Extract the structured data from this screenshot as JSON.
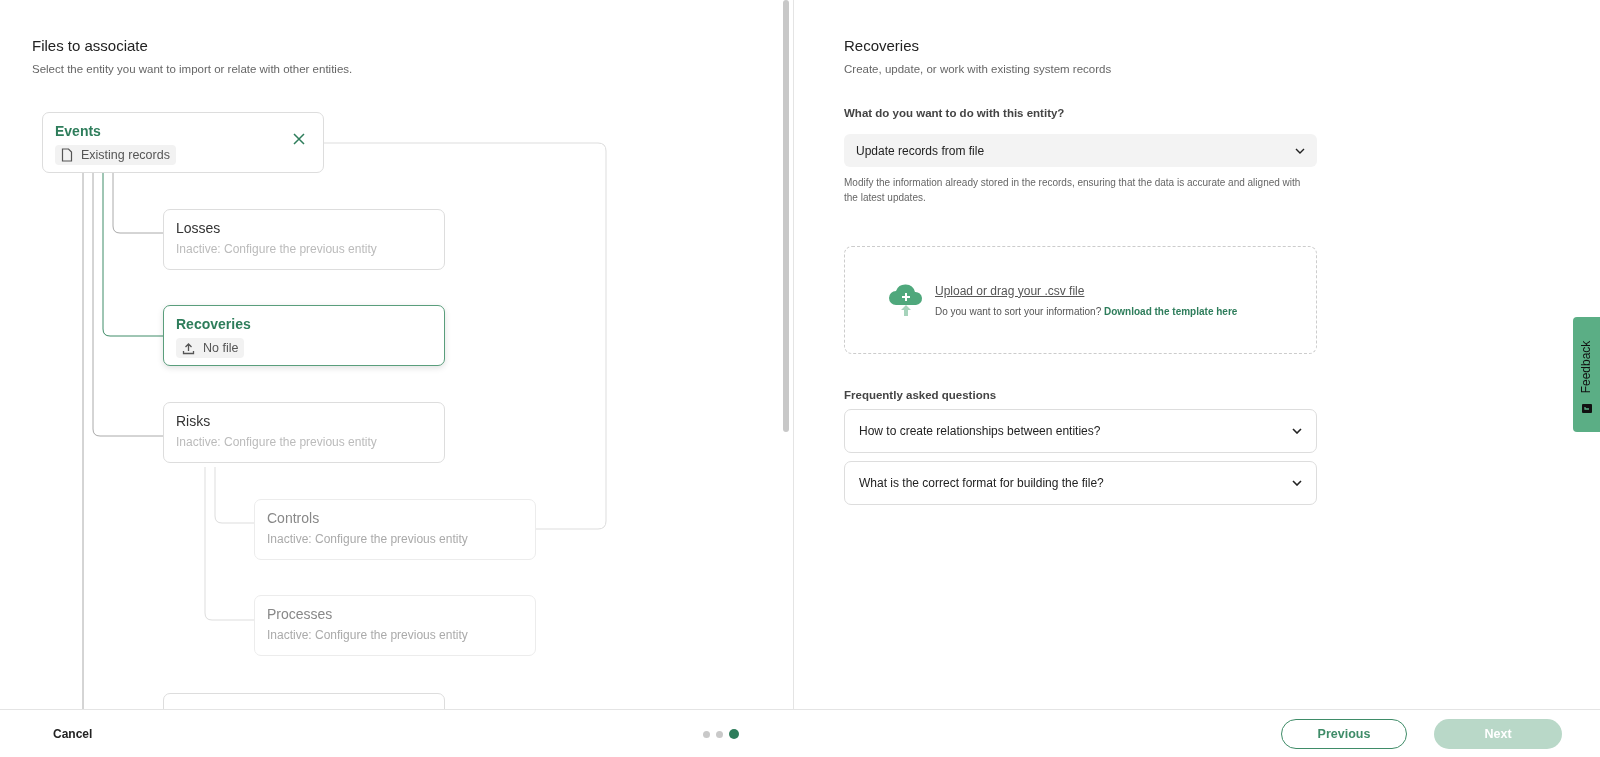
{
  "left_panel": {
    "title": "Files to associate",
    "subtitle": "Select the entity you want to import or relate with other entities."
  },
  "tree": [
    {
      "name": "Events",
      "complete": true,
      "selected": false,
      "disabled": false,
      "chip": {
        "label": "Existing records",
        "kind": "document"
      }
    },
    {
      "name": "Losses",
      "complete": false,
      "selected": false,
      "disabled": false,
      "note": "Inactive: Configure the previous entity"
    },
    {
      "name": "Recoveries",
      "complete": false,
      "selected": true,
      "disabled": false,
      "chip": {
        "label": "No file",
        "kind": "upload"
      }
    },
    {
      "name": "Risks",
      "complete": false,
      "selected": false,
      "disabled": false,
      "note": "Inactive: Configure the previous entity"
    },
    {
      "name": "Controls",
      "complete": false,
      "selected": false,
      "disabled": true,
      "note": "Inactive: Configure the previous entity"
    },
    {
      "name": "Processes",
      "complete": false,
      "selected": false,
      "disabled": true,
      "note": "Inactive: Configure the previous entity"
    },
    {
      "kind": "clipped"
    }
  ],
  "right_panel": {
    "title": "Recoveries",
    "subtitle": "Create, update, or work with existing system records",
    "question": "What do you want to do with this entity?",
    "action_select": {
      "value": "Update records from file"
    },
    "help": "Modify the information already stored in the records, ensuring that the data is accurate and aligned with the latest updates.",
    "upload": {
      "link": "Upload or drag your .csv file",
      "hint": "Do you want to sort your information? **Download the template here**"
    },
    "faq_title": "Frequently asked questions",
    "faq": [
      {
        "question": "How to create relationships between entities?",
        "expanded": false
      },
      {
        "question": "What is the correct format for building the file?",
        "expanded": false
      }
    ]
  },
  "feedback_tab": {
    "label": "Feedback"
  },
  "footer": {
    "cancel": "Cancel",
    "steps": [
      {
        "selected": false
      },
      {
        "selected": false
      },
      {
        "selected": true
      }
    ],
    "previous": "Previous",
    "next": {
      "label": "Next",
      "disabled": true
    }
  }
}
